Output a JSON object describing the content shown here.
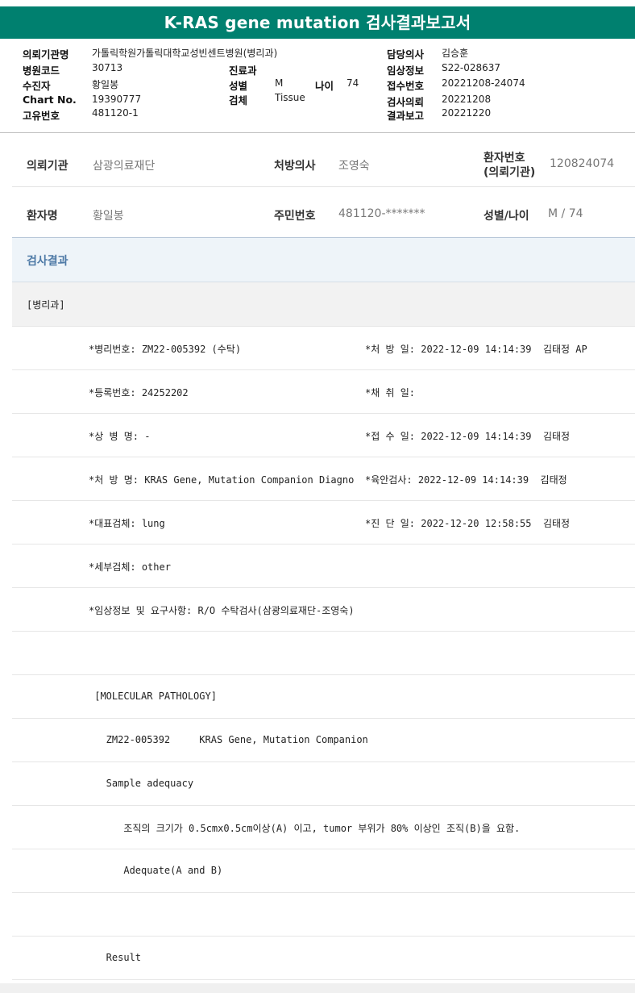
{
  "title": "K-RAS gene mutation 검사결과보고서",
  "header": {
    "requesting_org_label": "의뢰기관명",
    "requesting_org_value": "가톨릭학원가톨릭대학교성빈센트병원(병리과)",
    "hospital_code_label": "병원코드",
    "hospital_code_value": "30713",
    "dept_label": "진료과",
    "dept_value": "",
    "recipient_label": "수진자",
    "recipient_value": "황일봉",
    "sex_label": "성별",
    "sex_value": "M",
    "age_label": "나이",
    "age_value": "74",
    "chart_label": "Chart No.",
    "chart_value": "19390777",
    "specimen_label": "검체",
    "specimen_value": "Tissue",
    "unique_label": "고유번호",
    "unique_value": "481120-1",
    "doctor_label": "담당의사",
    "doctor_value": "김승훈",
    "clinical_label": "임상정보",
    "clinical_value": "S22-028637",
    "receipt_label": "접수번호",
    "receipt_value": "20221208-24074",
    "request_label": "검사의뢰",
    "request_value": "20221208",
    "report_label": "결과보고",
    "report_value": "20221220"
  },
  "patient": {
    "org_label": "의뢰기관",
    "org_value": "삼광의료재단",
    "prescriber_label": "처방의사",
    "prescriber_value": "조영숙",
    "patient_no_label_1": "환자번호",
    "patient_no_label_2": "(의뢰기관)",
    "patient_no_value": "120824074",
    "name_label": "환자명",
    "name_value": "황일봉",
    "rrn_label": "주민번호",
    "rrn_value": "481120-*******",
    "sexage_label": "성별/나이",
    "sexage_value": "M / 74"
  },
  "section_title": "검사결과",
  "sub_section": "[병리과]",
  "report": {
    "row1_left": "*병리번호: ZM22-005392 (수탁)",
    "row1_right": "*처 방 일: 2022-12-09 14:14:39  김태정 AP",
    "row2_left": "*등록번호: 24252202",
    "row2_right": "*채 취 일:",
    "row3_left": "*상 병 명: -",
    "row3_right": "*접 수 일: 2022-12-09 14:14:39  김태정",
    "row4_left": "*처 방 명: KRAS Gene, Mutation Companion Diagno",
    "row4_right": "*육안검사: 2022-12-09 14:14:39  김태정",
    "row5_left": "*대표검체: lung",
    "row5_right": "*진 단 일: 2022-12-20 12:58:55  김태정",
    "row6_left": "*세부검체: other",
    "row7_left": "*임상정보 및 요구사항: R/O 수탁검사(삼광의료재단-조영숙)",
    "row8_left": "",
    "row9_left": " [MOLECULAR PATHOLOGY]",
    "row10_left": "   ZM22-005392     KRAS Gene, Mutation Companion",
    "row11_left": "   Sample adequacy",
    "row12_left": "      조직의 크기가 0.5cmx0.5cm이상(A) 이고, tumor 부위가 80% 이상인 조직(B)을 요함.",
    "row13_left": "      Adequate(A and B)",
    "row14_left": "",
    "row15_left": "   Result"
  }
}
